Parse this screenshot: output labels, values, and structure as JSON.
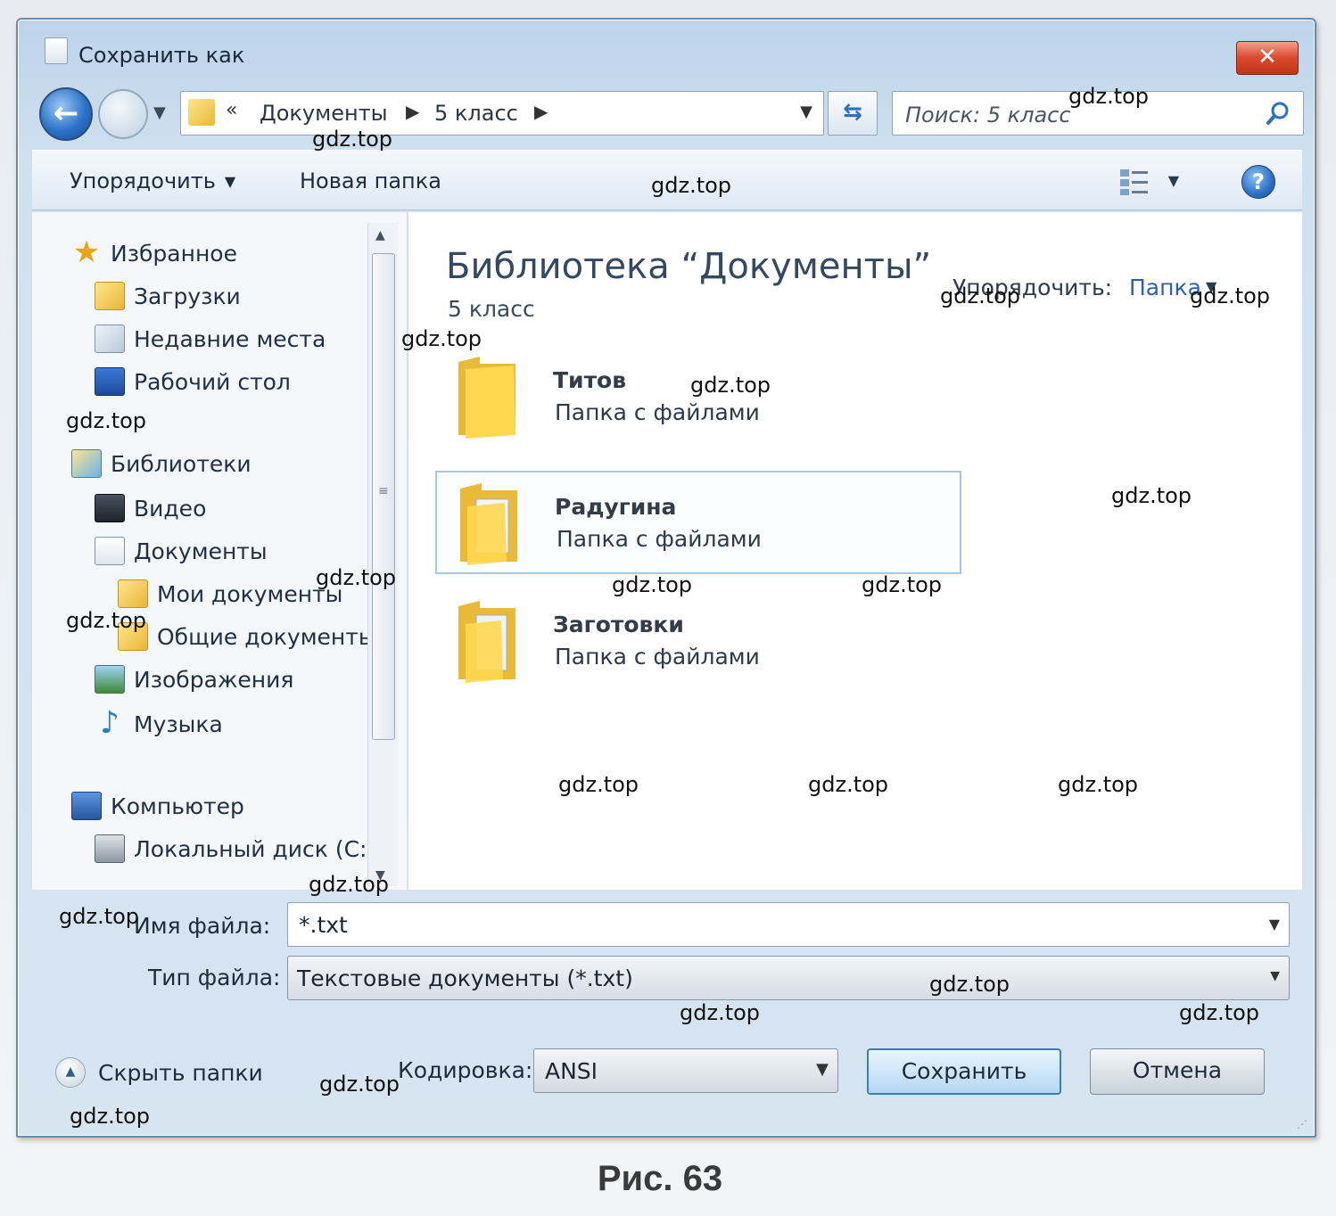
{
  "window": {
    "title": "Сохранить как",
    "close_label": "✕"
  },
  "address": {
    "chevron": "«",
    "crumbs": [
      "Документы",
      "5 класс"
    ],
    "separator": "▶"
  },
  "search": {
    "placeholder": "Поиск: 5 класс"
  },
  "toolbar": {
    "organize_label": "Упорядочить",
    "new_folder_label": "Новая папка",
    "help_label": "?"
  },
  "nav_pane": {
    "favorites": "Избранное",
    "downloads": "Загрузки",
    "recent": "Недавние места",
    "desktop": "Рабочий стол",
    "libraries": "Библиотеки",
    "video": "Видео",
    "documents": "Документы",
    "my_documents": "Мои документы",
    "public_documents": "Общие документы",
    "images": "Изображения",
    "music": "Музыка",
    "computer": "Компьютер",
    "local_disk": "Локальный диск (C:)"
  },
  "content": {
    "library_title": "Библиотека “Документы”",
    "library_subtitle": "5 класс",
    "arrange_label": "Упорядочить:",
    "arrange_value": "Папка",
    "folders": [
      {
        "name": "Титов",
        "type": "Папка с файлами"
      },
      {
        "name": "Радугина",
        "type": "Папка с файлами"
      },
      {
        "name": "Заготовки",
        "type": "Папка с файлами"
      }
    ]
  },
  "form": {
    "filename_label": "Имя файла:",
    "filename_value": "*.txt",
    "filetype_label": "Тип файла:",
    "filetype_value": "Текстовые документы (*.txt)",
    "encoding_label": "Кодировка:",
    "encoding_value": "ANSI",
    "hide_folders_label": "Скрыть папки",
    "save_label": "Сохранить",
    "cancel_label": "Отмена"
  },
  "caption": "Рис. 63",
  "watermark": "gdz.top",
  "colors": {
    "close_button": "#d9492d",
    "accent_blue": "#2d5fb3",
    "selection_border": "#a6c8e8"
  }
}
